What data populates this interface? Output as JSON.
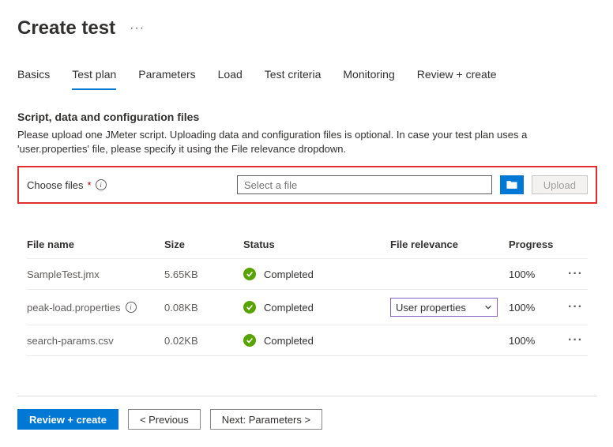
{
  "header": {
    "title": "Create test"
  },
  "tabs": [
    {
      "label": "Basics",
      "active": false
    },
    {
      "label": "Test plan",
      "active": true
    },
    {
      "label": "Parameters",
      "active": false
    },
    {
      "label": "Load",
      "active": false
    },
    {
      "label": "Test criteria",
      "active": false
    },
    {
      "label": "Monitoring",
      "active": false
    },
    {
      "label": "Review + create",
      "active": false
    }
  ],
  "section": {
    "heading": "Script, data and configuration files",
    "description": "Please upload one JMeter script. Uploading data and configuration files is optional. In case your test plan uses a 'user.properties' file, please specify it using the File relevance dropdown."
  },
  "chooser": {
    "label": "Choose files",
    "placeholder": "Select a file",
    "upload_label": "Upload"
  },
  "table": {
    "headers": {
      "name": "File name",
      "size": "Size",
      "status": "Status",
      "relevance": "File relevance",
      "progress": "Progress"
    },
    "rows": [
      {
        "name": "SampleTest.jmx",
        "has_info": false,
        "size": "5.65KB",
        "status": "Completed",
        "relevance": null,
        "progress": "100%"
      },
      {
        "name": "peak-load.properties",
        "has_info": true,
        "size": "0.08KB",
        "status": "Completed",
        "relevance": "User properties",
        "progress": "100%"
      },
      {
        "name": "search-params.csv",
        "has_info": false,
        "size": "0.02KB",
        "status": "Completed",
        "relevance": null,
        "progress": "100%"
      }
    ]
  },
  "footer": {
    "review": "Review + create",
    "previous": "< Previous",
    "next": "Next: Parameters >"
  }
}
